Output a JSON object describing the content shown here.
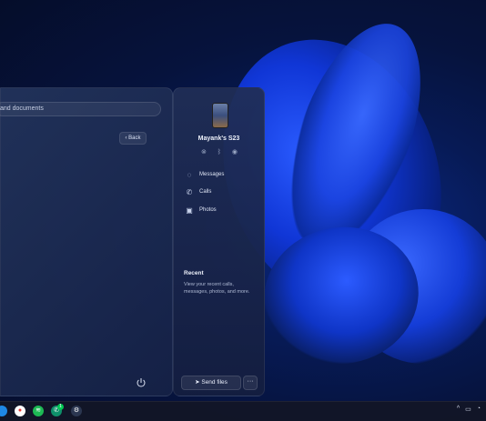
{
  "start_panel": {
    "search_placeholder": "and documents",
    "back_label": "Back"
  },
  "phone_panel": {
    "device_name": "Mayank's S23",
    "menu": [
      {
        "label": "Messages",
        "icon": "messages-icon"
      },
      {
        "label": "Calls",
        "icon": "phone-icon"
      },
      {
        "label": "Photos",
        "icon": "photos-icon"
      }
    ],
    "recent": {
      "title": "Recent",
      "description": "View your recent calls, messages, photos, and more."
    },
    "send_label": "Send files",
    "more_label": "···"
  },
  "taskbar": {
    "badge": "1"
  },
  "colors": {
    "accent": "#2a5bff",
    "spotify": "#1db954"
  }
}
